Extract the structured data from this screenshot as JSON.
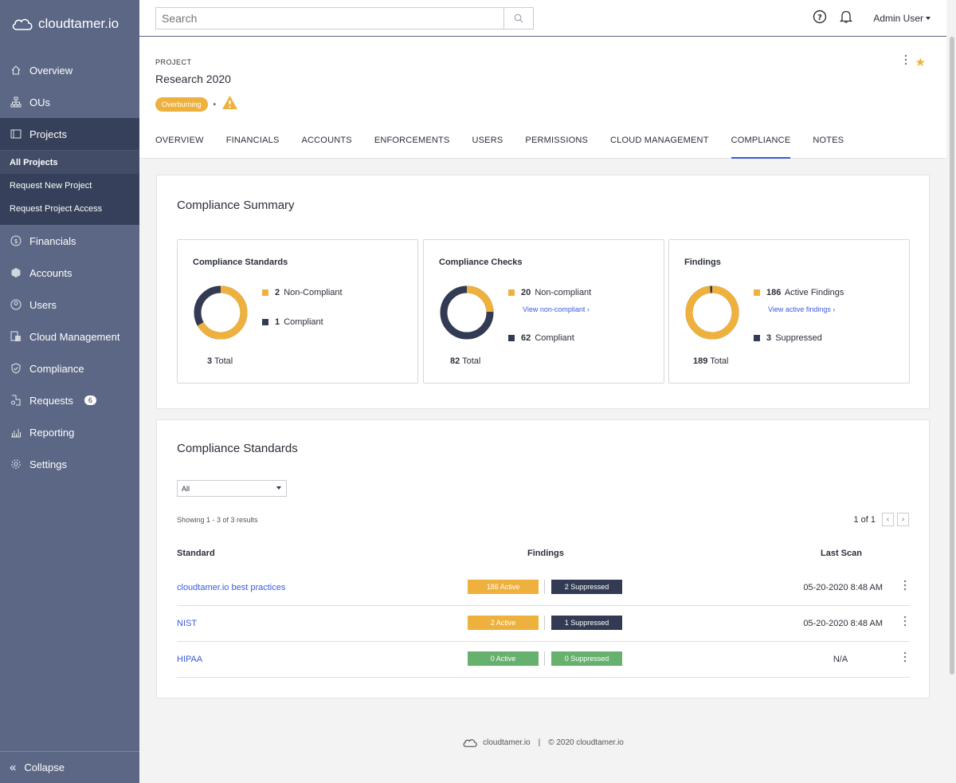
{
  "brand": "cloudtamer.io",
  "search": {
    "placeholder": "Search"
  },
  "user": {
    "name": "Admin User"
  },
  "sidebar": {
    "items": [
      {
        "label": "Overview"
      },
      {
        "label": "OUs"
      },
      {
        "label": "Projects"
      },
      {
        "label": "Financials"
      },
      {
        "label": "Accounts"
      },
      {
        "label": "Users"
      },
      {
        "label": "Cloud Management"
      },
      {
        "label": "Compliance"
      },
      {
        "label": "Requests",
        "badge": "6"
      },
      {
        "label": "Reporting"
      },
      {
        "label": "Settings"
      }
    ],
    "sub_items": [
      {
        "label": "All Projects"
      },
      {
        "label": "Request New Project"
      },
      {
        "label": "Request Project Access"
      }
    ],
    "collapse": "Collapse"
  },
  "project": {
    "label": "PROJECT",
    "title": "Research 2020",
    "status": "Overburning"
  },
  "tabs": [
    {
      "label": "OVERVIEW"
    },
    {
      "label": "FINANCIALS"
    },
    {
      "label": "ACCOUNTS"
    },
    {
      "label": "ENFORCEMENTS"
    },
    {
      "label": "USERS"
    },
    {
      "label": "PERMISSIONS"
    },
    {
      "label": "CLOUD MANAGEMENT"
    },
    {
      "label": "COMPLIANCE"
    },
    {
      "label": "NOTES"
    }
  ],
  "summary": {
    "title": "Compliance Summary",
    "standards": {
      "title": "Compliance Standards",
      "noncompliant": "2",
      "noncompliant_label": "Non-Compliant",
      "compliant": "1",
      "compliant_label": "Compliant",
      "total": "3",
      "total_label": "Total",
      "fraction": 0.667
    },
    "checks": {
      "title": "Compliance Checks",
      "noncompliant": "20",
      "noncompliant_label": "Non-compliant",
      "link": "View non-compliant ›",
      "compliant": "62",
      "compliant_label": "Compliant",
      "total": "82",
      "total_label": "Total",
      "fraction": 0.244
    },
    "findings": {
      "title": "Findings",
      "active": "186",
      "active_label": "Active Findings",
      "link": "View active findings ›",
      "suppressed": "3",
      "suppressed_label": "Suppressed",
      "total": "189",
      "total_label": "Total",
      "fraction": 0.984
    }
  },
  "standards_table": {
    "title": "Compliance Standards",
    "filter": "All",
    "showing": "Showing 1 - 3 of 3 results",
    "page": "1 of 1",
    "headers": {
      "standard": "Standard",
      "findings": "Findings",
      "last_scan": "Last Scan"
    },
    "rows": [
      {
        "name": "cloudtamer.io best practices",
        "active": "186 Active",
        "suppressed": "2 Suppressed",
        "last_scan": "05-20-2020 8:48 AM"
      },
      {
        "name": "NIST",
        "active": "2 Active",
        "suppressed": "1 Suppressed",
        "last_scan": "05-20-2020 8:48 AM"
      },
      {
        "name": "HIPAA",
        "active": "0 Active",
        "suppressed": "0 Suppressed",
        "last_scan": "N/A"
      }
    ]
  },
  "footer": {
    "copyright": "© 2020 cloudtamer.io"
  },
  "colors": {
    "orange": "#efb13d",
    "navy": "#323b53",
    "green": "#67b16e",
    "link": "#3b5bdb",
    "sidebar": "#5b6784"
  }
}
